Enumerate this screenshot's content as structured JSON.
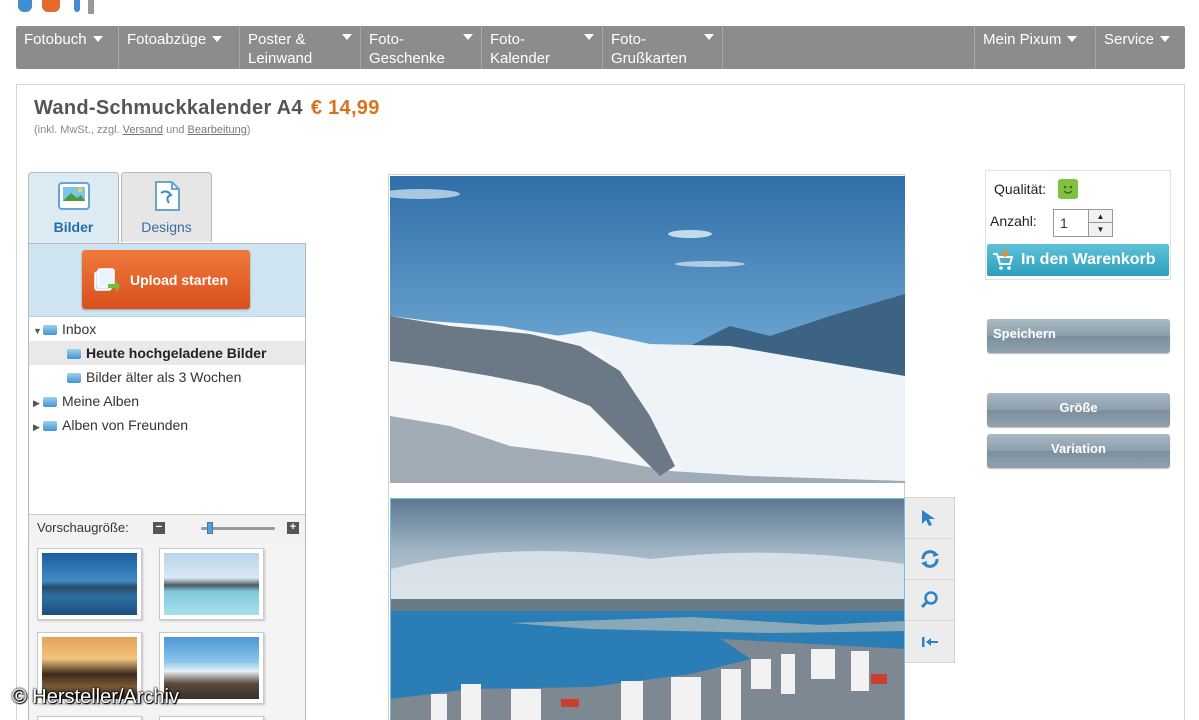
{
  "nav": {
    "items": [
      {
        "label": "Fotobuch"
      },
      {
        "label": "Fotoabzüge"
      },
      {
        "label_line1": "Poster &",
        "label_line2": "Leinwand"
      },
      {
        "label_line1": "Foto-",
        "label_line2": "Geschenke"
      },
      {
        "label_line1": "Foto-",
        "label_line2": "Kalender"
      },
      {
        "label_line1": "Foto-",
        "label_line2": "Grußkarten"
      }
    ],
    "right_items": [
      {
        "label": "Mein Pixum"
      },
      {
        "label": "Service"
      }
    ]
  },
  "product": {
    "title": "Wand-Schmuckkalender A4",
    "price": "€ 14,99",
    "note_prefix": "(inkl. MwSt., zzgl.",
    "link_shipping": "Versand",
    "note_and": "und",
    "link_processing": "Bearbeitung",
    "note_suffix": ")"
  },
  "tabs": {
    "bilder": "Bilder",
    "designs": "Designs"
  },
  "upload": {
    "label": "Upload starten"
  },
  "tree": {
    "items": [
      {
        "label": "Inbox",
        "arrow": "▼"
      },
      {
        "label": "Heute hochgeladene Bilder"
      },
      {
        "label": "Bilder älter als 3 Wochen"
      },
      {
        "label": "Meine Alben",
        "arrow": "▶"
      },
      {
        "label": "Alben von Freunden",
        "arrow": "▶"
      }
    ]
  },
  "preview": {
    "label": "Vorschaugröße:",
    "minus": "−",
    "plus": "+"
  },
  "order": {
    "quality_label": "Qualität:",
    "quantity_label": "Anzahl:",
    "quantity_value": "1",
    "cart_label": "In den Warenkorb"
  },
  "actions": {
    "save": "Speichern",
    "size": "Größe",
    "variation": "Variation"
  },
  "watermark": "© Hersteller/Archiv",
  "colors": {
    "accent_price": "#d9721c",
    "nav_bg": "#8c8c8c",
    "upload_orange": "#e5602a",
    "cart_teal": "#2d9fbd"
  }
}
